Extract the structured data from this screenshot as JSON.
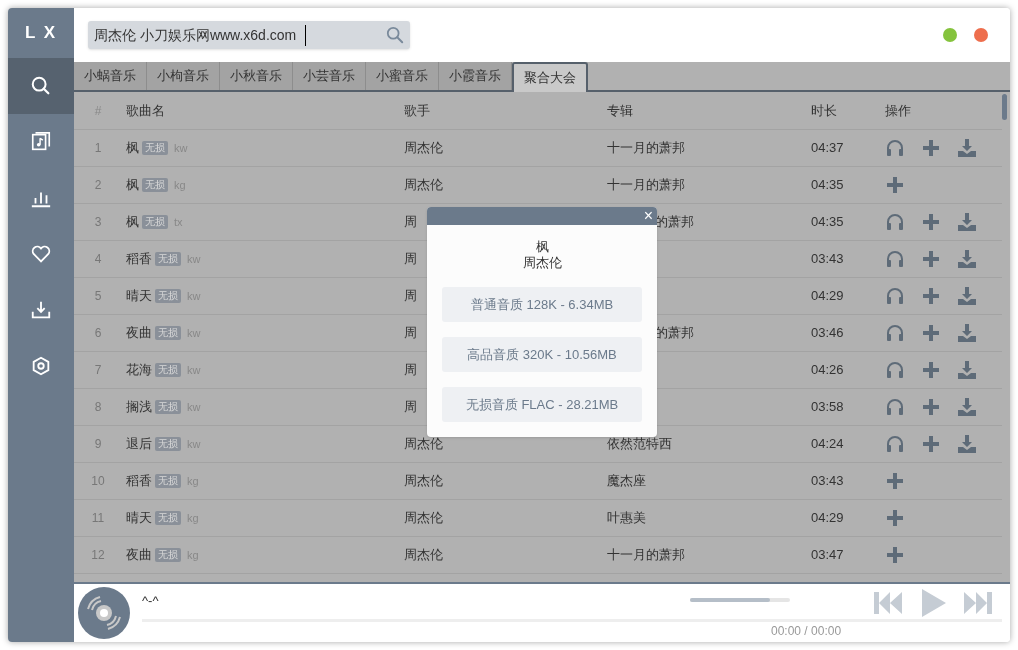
{
  "sidebar": {
    "logo": "L X",
    "items": [
      {
        "selected": true
      },
      {
        "selected": false
      },
      {
        "selected": false
      },
      {
        "selected": false
      },
      {
        "selected": false
      },
      {
        "selected": false
      }
    ]
  },
  "search": {
    "value": "周杰伦 小刀娱乐网www.x6d.com"
  },
  "tabs": [
    {
      "label": "小蜗音乐",
      "selected": false
    },
    {
      "label": "小枸音乐",
      "selected": false
    },
    {
      "label": "小秋音乐",
      "selected": false
    },
    {
      "label": "小芸音乐",
      "selected": false
    },
    {
      "label": "小蜜音乐",
      "selected": false
    },
    {
      "label": "小霞音乐",
      "selected": false
    },
    {
      "label": "聚合大会",
      "selected": true
    }
  ],
  "table": {
    "columns": [
      "#",
      "歌曲名",
      "歌手",
      "专辑",
      "时长",
      "操作"
    ],
    "rows": [
      {
        "index": "1",
        "name": "枫",
        "badge": "无损",
        "source": "kw",
        "artist": "周杰伦",
        "album": "十一月的萧邦",
        "duration": "04:37",
        "listen": true,
        "download": true
      },
      {
        "index": "2",
        "name": "枫",
        "badge": "无损",
        "source": "kg",
        "artist": "周杰伦",
        "album": "十一月的萧邦",
        "duration": "04:35",
        "listen": false,
        "download": false
      },
      {
        "index": "3",
        "name": "枫",
        "badge": "无损",
        "source": "tx",
        "artist": "周",
        "album": "的萧邦",
        "album_clipped": true,
        "duration": "04:35",
        "listen": true,
        "download": true
      },
      {
        "index": "4",
        "name": "稻香",
        "badge": "无损",
        "source": "kw",
        "artist": "周",
        "duration": "03:43",
        "listen": true,
        "download": true
      },
      {
        "index": "5",
        "name": "晴天",
        "badge": "无损",
        "source": "kw",
        "artist": "周",
        "duration": "04:29",
        "listen": true,
        "download": true
      },
      {
        "index": "6",
        "name": "夜曲",
        "badge": "无损",
        "source": "kw",
        "artist": "周",
        "album": "的萧邦",
        "album_clipped": true,
        "duration": "03:46",
        "listen": true,
        "download": true
      },
      {
        "index": "7",
        "name": "花海",
        "badge": "无损",
        "source": "kw",
        "artist": "周",
        "duration": "04:26",
        "listen": true,
        "download": true
      },
      {
        "index": "8",
        "name": "搁浅",
        "badge": "无损",
        "source": "kw",
        "artist": "周",
        "duration": "03:58",
        "listen": true,
        "download": true
      },
      {
        "index": "9",
        "name": "退后",
        "badge": "无损",
        "source": "kw",
        "artist": "周杰伦",
        "album": "依然范特西",
        "duration": "04:24",
        "listen": true,
        "download": true
      },
      {
        "index": "10",
        "name": "稻香",
        "badge": "无损",
        "source": "kg",
        "artist": "周杰伦",
        "album": "魔杰座",
        "duration": "03:43",
        "listen": false,
        "download": false
      },
      {
        "index": "11",
        "name": "晴天",
        "badge": "无损",
        "source": "kg",
        "artist": "周杰伦",
        "album": "叶惠美",
        "duration": "04:29",
        "listen": false,
        "download": false
      },
      {
        "index": "12",
        "name": "夜曲",
        "badge": "无损",
        "source": "kg",
        "artist": "周杰伦",
        "album": "十一月的萧邦",
        "duration": "03:47",
        "listen": false,
        "download": false
      }
    ]
  },
  "dialog": {
    "close": "×",
    "title": "枫",
    "artist": "周杰伦",
    "options": [
      "普通音质 128K - 6.34MB",
      "高品音质 320K - 10.56MB",
      "无损音质 FLAC - 28.21MB"
    ]
  },
  "player": {
    "title": "^-^",
    "level": 0,
    "volume": {
      "level": 0.8
    },
    "time": "00:00 / 00:00"
  }
}
